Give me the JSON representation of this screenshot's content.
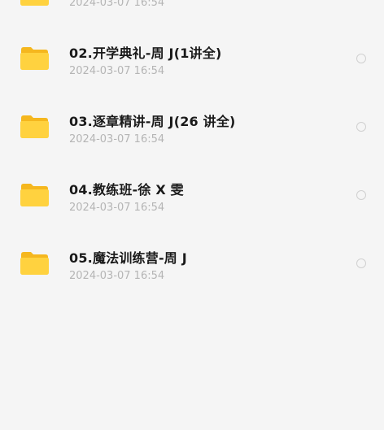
{
  "files": [
    {
      "name": "",
      "date": "2024-03-07 16:54"
    },
    {
      "name": "02.开学典礼-周 J(1讲全)",
      "date": "2024-03-07 16:54"
    },
    {
      "name": "03.逐章精讲-周 J(26 讲全)",
      "date": "2024-03-07 16:54"
    },
    {
      "name": "04.教练班-徐 X 雯",
      "date": "2024-03-07 16:54"
    },
    {
      "name": "05.魔法训练营-周 J",
      "date": "2024-03-07 16:54"
    }
  ],
  "icons": {
    "folder": "folder-icon",
    "select": "radio-circle"
  },
  "colors": {
    "folder_back": "#f5b71e",
    "folder_front": "#ffd23f",
    "background": "#f5f5f5"
  }
}
